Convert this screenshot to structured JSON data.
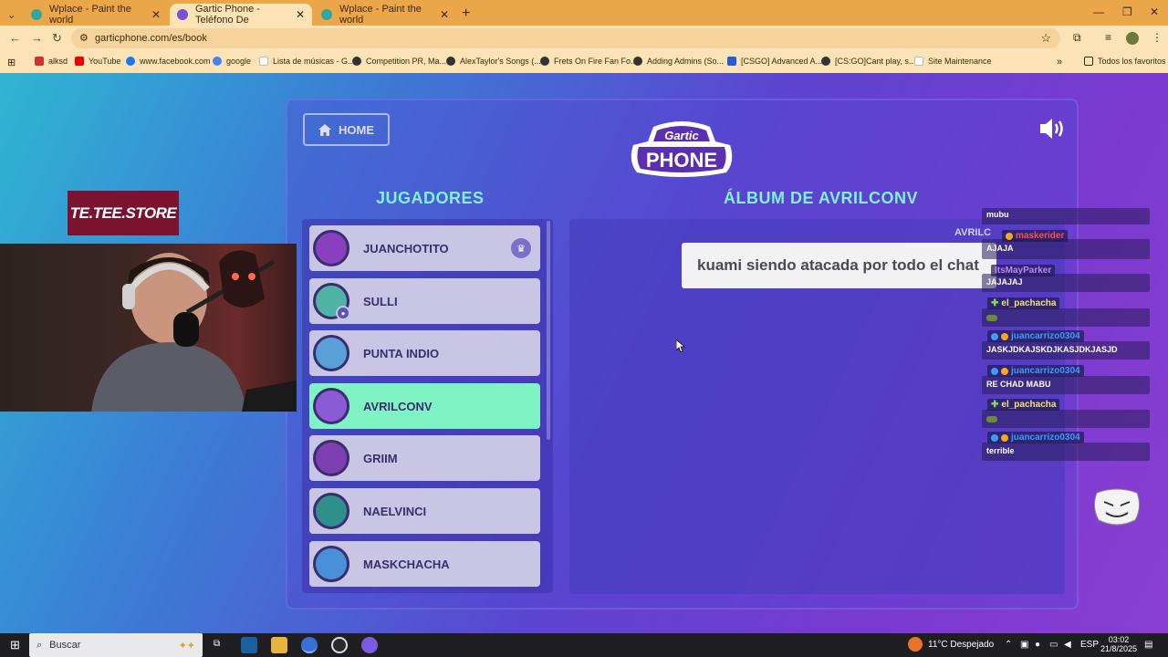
{
  "browser": {
    "tabs": [
      {
        "title": "Wplace - Paint the world",
        "color": "#2fa6a0"
      },
      {
        "title": "Gartic Phone - Teléfono De",
        "color": "#7b4fd6"
      },
      {
        "title": "Wplace - Paint the world",
        "color": "#2fa6a0"
      }
    ],
    "url": "garticphone.com/es/book",
    "bookmarks": [
      "alksd",
      "YouTube",
      "www.facebook.com",
      "google",
      "Lista de músicas - G...",
      "Competition PR, Ma...",
      "AlexTaylor's Songs (...",
      "Frets On Fire Fan Fo...",
      "Adding Admins (So...",
      "[CSGO] Advanced A...",
      "[CS:GO]Cant play, s...",
      "Site Maintenance"
    ],
    "all_favorites": "Todos los favoritos"
  },
  "game": {
    "home_label": "HOME",
    "logo_top": "Gartic",
    "logo_bottom": "PHONE",
    "players_heading": "JUGADORES",
    "album_heading": "ÁLBUM DE AVRILCONV",
    "album_owner_label": "AVRILC",
    "caption": "kuami siendo atacada por todo el chat",
    "players": [
      {
        "name": "JUANCHOTITO",
        "color": "#8a3fbf",
        "host": true,
        "selected": false
      },
      {
        "name": "SULLI",
        "color": "#4fb3a6",
        "host": false,
        "selected": false,
        "self": true
      },
      {
        "name": "PUNTA INDIO",
        "color": "#5aa0d8",
        "host": false,
        "selected": false
      },
      {
        "name": "AVRILCONV",
        "color": "#8b5bd6",
        "host": false,
        "selected": true
      },
      {
        "name": "GRIIM",
        "color": "#7b3fb0",
        "host": false,
        "selected": false
      },
      {
        "name": "NAELVINCI",
        "color": "#2f8f8a",
        "host": false,
        "selected": false
      },
      {
        "name": "MASKCHACHA",
        "color": "#4a90d8",
        "host": false,
        "selected": false
      }
    ]
  },
  "chat": [
    {
      "user": "",
      "text": "mubu",
      "user_color": "#ffffff"
    },
    {
      "user": "maskerider",
      "text": "AJAJA",
      "user_color": "#ff4d4d"
    },
    {
      "user": "ItsMayParker",
      "text": "JAJAJAJ",
      "user_color": "#c084fc"
    },
    {
      "user": "el_pachacha",
      "text": "",
      "user_color": "#f5e27a"
    },
    {
      "user": "juancarrizo0304",
      "text": "JASKJDKAJSKDJKASJDKJASJD",
      "user_color": "#3b9cff"
    },
    {
      "user": "juancarrizo0304",
      "text": "RE CHAD MABU",
      "user_color": "#3b9cff"
    },
    {
      "user": "el_pachacha",
      "text": "",
      "user_color": "#f5e27a"
    },
    {
      "user": "juancarrizo0304",
      "text": "terrible",
      "user_color": "#3b9cff"
    }
  ],
  "overlay": {
    "store": "TE.TEE.STORE"
  },
  "taskbar": {
    "search": "Buscar",
    "weather": "11°C  Despejado",
    "lang": "ESP",
    "time": "03:02",
    "date": "21/8/2025"
  }
}
